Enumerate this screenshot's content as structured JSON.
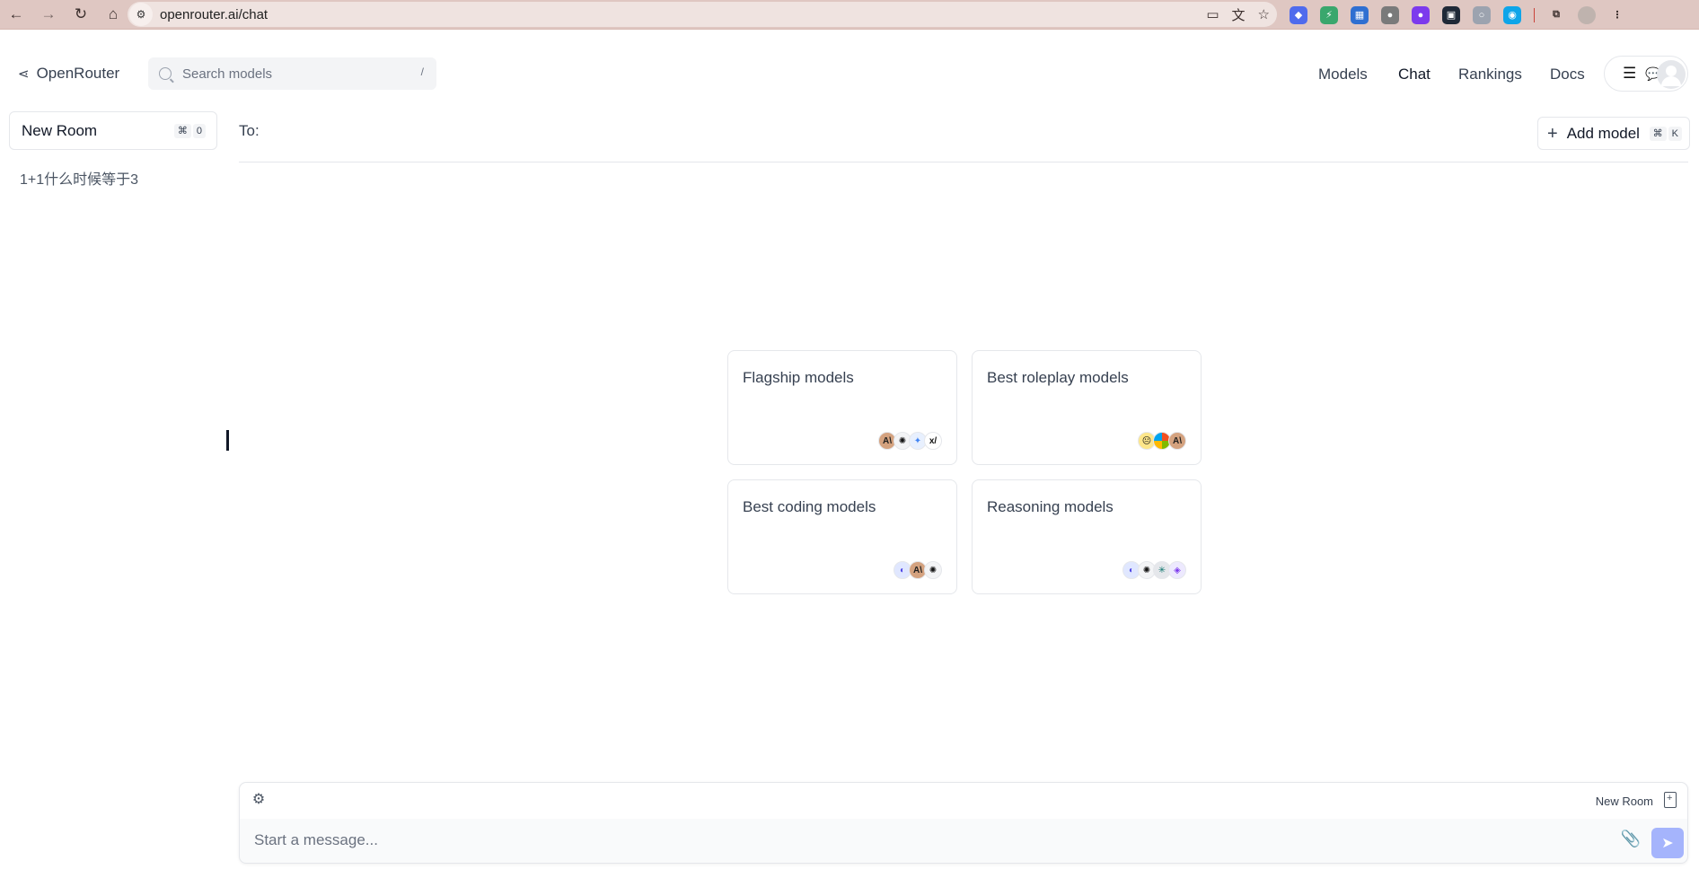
{
  "browser": {
    "url": "openrouter.ai/chat",
    "nav_icons": [
      "back-icon",
      "forward-icon",
      "reload-icon",
      "home-icon"
    ],
    "omnibox_icons": [
      "install-app-icon",
      "translate-icon",
      "bookmark-star-icon"
    ],
    "extensions": [
      {
        "name": "ext-blue-icon",
        "glyph": "◆",
        "color": "#4f6bed"
      },
      {
        "name": "ext-green-icon",
        "glyph": "⚡",
        "color": "#3aa76d"
      },
      {
        "name": "ext-grid-icon",
        "glyph": "▦",
        "color": "#2f6fd1"
      },
      {
        "name": "ext-gray-icon",
        "glyph": "●",
        "color": "#7a7a7a"
      },
      {
        "name": "ext-purple-icon",
        "glyph": "●",
        "color": "#7c3aed"
      },
      {
        "name": "ext-dark-icon",
        "glyph": "▣",
        "color": "#1f2937"
      },
      {
        "name": "ext-chat-icon",
        "glyph": "○",
        "color": "#9ca3af"
      },
      {
        "name": "ext-color-icon",
        "glyph": "◉",
        "color": "#0ea5e9"
      },
      {
        "name": "extensions-puzzle-icon",
        "glyph": "⧉",
        "color": "#3a2e2c"
      }
    ]
  },
  "header": {
    "brand": "OpenRouter",
    "search_placeholder": "Search models",
    "search_shortcut": "/",
    "nav": [
      {
        "label": "Models",
        "active": false
      },
      {
        "label": "Chat",
        "active": true
      },
      {
        "label": "Rankings",
        "active": false
      },
      {
        "label": "Docs",
        "active": false
      }
    ]
  },
  "sidebar": {
    "new_room_label": "New Room",
    "new_room_shortcut": [
      "⌘",
      "0"
    ],
    "rooms": [
      "1+1什么时候等于3"
    ]
  },
  "to_bar": {
    "label": "To:",
    "add_model_label": "Add model",
    "add_model_shortcut": [
      "⌘",
      "K"
    ]
  },
  "cards": [
    {
      "title": "Flagship models",
      "logos": [
        {
          "cls": "lg-anthropic",
          "g": "A\\"
        },
        {
          "cls": "lg-openai",
          "g": "✺"
        },
        {
          "cls": "lg-gemini",
          "g": "✦"
        },
        {
          "cls": "lg-xai",
          "g": "x/"
        }
      ]
    },
    {
      "title": "Best roleplay models",
      "logos": [
        {
          "cls": "lg-emoji",
          "g": "😐"
        },
        {
          "cls": "lg-ms",
          "g": ""
        },
        {
          "cls": "lg-anthropic",
          "g": "A\\"
        }
      ]
    },
    {
      "title": "Best coding models",
      "logos": [
        {
          "cls": "lg-deepseek",
          "g": "◐"
        },
        {
          "cls": "lg-anthropic",
          "g": "A\\"
        },
        {
          "cls": "lg-openai",
          "g": "✺"
        }
      ]
    },
    {
      "title": "Reasoning models",
      "logos": [
        {
          "cls": "lg-deepseek",
          "g": "◐"
        },
        {
          "cls": "lg-openai",
          "g": "✺"
        },
        {
          "cls": "lg-perp",
          "g": "✳"
        },
        {
          "cls": "lg-qwen",
          "g": "◈"
        }
      ]
    }
  ],
  "composer": {
    "room_name": "New Room",
    "placeholder": "Start a message..."
  }
}
